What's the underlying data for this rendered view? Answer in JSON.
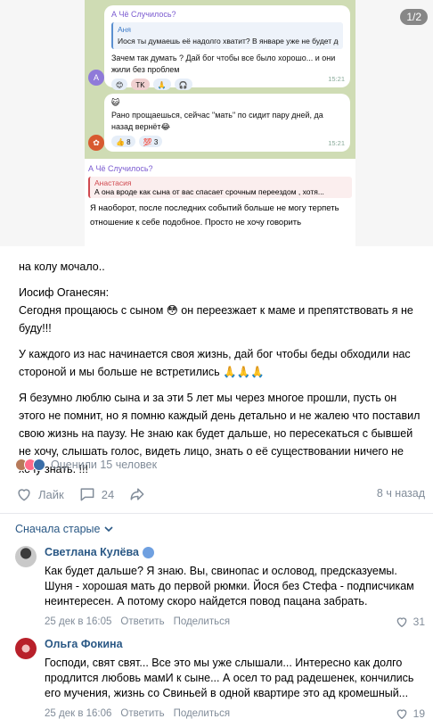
{
  "image": {
    "counter": "1/2",
    "msg1": {
      "reply_from": "А Чё Случилось?",
      "quote_name": "Аня",
      "quote_text": "Иося ты думаешь её надолго хватит? В январе уже не будет ден...",
      "text": "Зачем так думать ? Дай бог чтобы все было хорошо... и они жили без проблем",
      "reactions": [
        "😊",
        "TK",
        "🙏",
        "🎧"
      ],
      "time": "15:21",
      "avatar_letter": "А"
    },
    "msg2": {
      "icon": "😺",
      "text": "Рано прощаешься, сейчас \"мать\" по сидит пару дней, да назад вернёт😂",
      "reactions": [
        "👍 8",
        "💯 3"
      ],
      "time": "15:21"
    },
    "msg3": {
      "reply_from": "А Чё Случилось?",
      "quote_name": "Анастасия",
      "quote_text": "А она вроде как сына от вас спасает срочным переездом , хотя...",
      "text": "Я наоборот, после последних событий больше не могу терпеть отношение к себе подобное. Просто не хочу говорить"
    }
  },
  "post": {
    "p1": "на колу мочало..",
    "p2_author": "Иосиф Оганесян:",
    "p2_text": "Сегодня прощаюсь с сыном 😳 он переезжает к маме и препятствовать я не буду!!!",
    "p3": "У каждого из нас начинается своя жизнь, дай бог чтобы беды обходили нас стороной и мы больше не встретились 🙏🙏🙏",
    "p4": "Я безумно люблю сына и за эти 5 лет мы через многое прошли, пусть он этого не помнит, но я помню каждый день детально и не жалею что поставил свою жизнь на паузу. Не знаю как будет дальше, но пересекаться с бывшей не хочу, слышать голос, видеть лицо, знать о её существовании ничего не хочу знать. !!!"
  },
  "liked": "Оценили 15 человек",
  "actions": {
    "like_label": "Лайк",
    "comments_count": "24",
    "time": "8 ч назад"
  },
  "sort_label": "Сначала старые",
  "comments": [
    {
      "name": "Светлана Кулёва",
      "text": "Как будет дальше? Я знаю. Вы, свинопас и ословод, предсказуемы. Шуня - хорошая мать до первой рюмки. Йося без Стефа - подписчикам неинтересен. А потому скоро найдется повод пацана забрать.",
      "date": "25 дек в 16:05",
      "reply": "Ответить",
      "share": "Поделиться",
      "likes": "31"
    },
    {
      "name": "Ольга Фокина",
      "text": "Господи, свят свят... Все это мы уже слышали... Интересно как долго продлится любовь мамИ к сыне... А осел то рад радешенек, кончились его мучения, жизнь со Свиньей в одной квартире это ад кромешный...",
      "date": "25 дек в 16:06",
      "reply": "Ответить",
      "share": "Поделиться",
      "likes": "19"
    }
  ],
  "colors": {
    "link": "#2a5885",
    "muted": "#818c99",
    "tg_bg": "#cfdcb4"
  }
}
